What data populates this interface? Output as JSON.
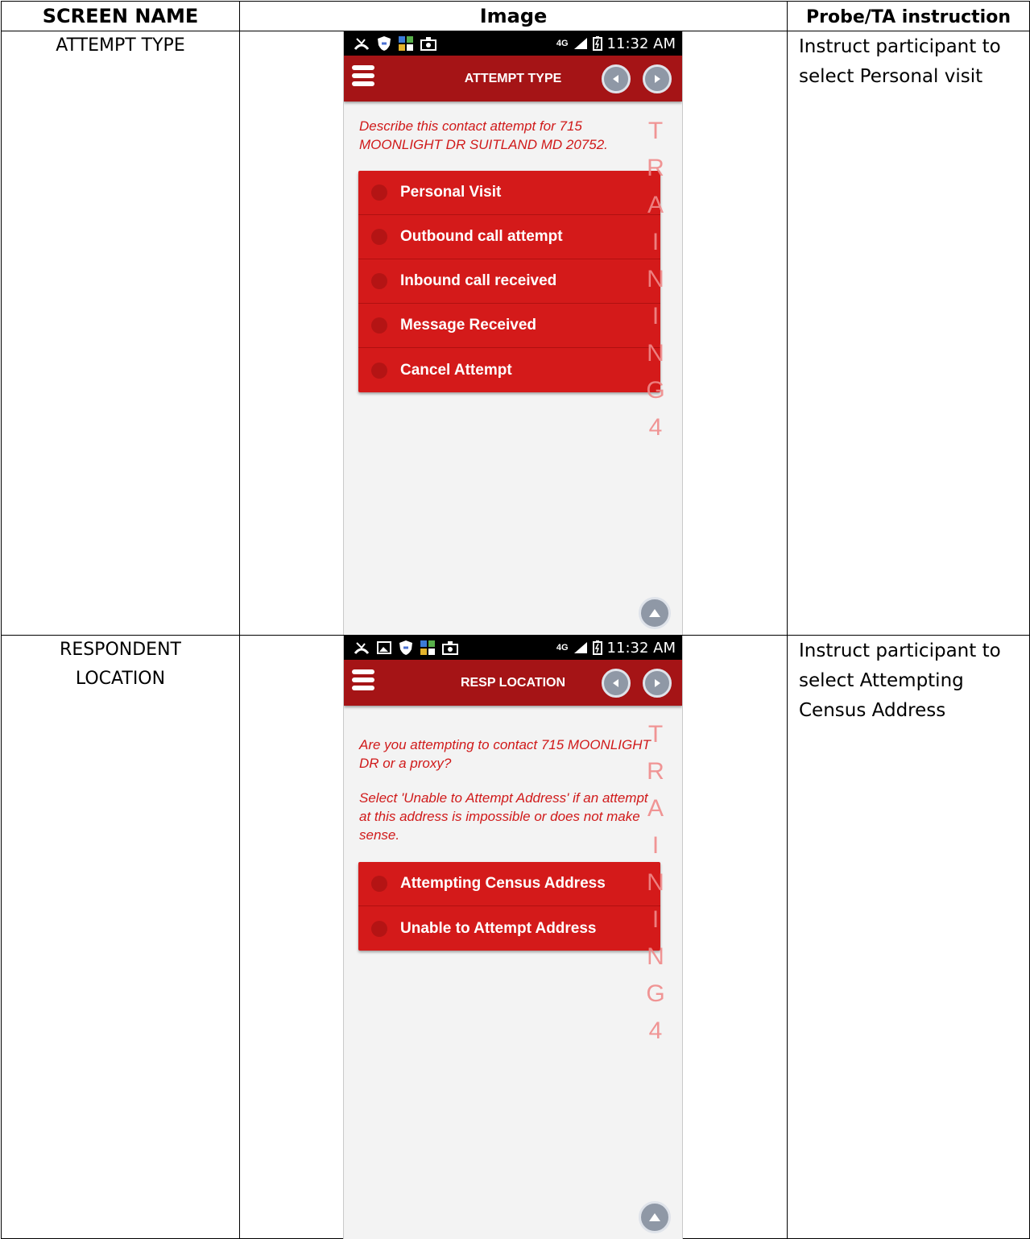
{
  "headers": {
    "screen_name": "SCREEN NAME",
    "image": "Image",
    "probe": "Probe/TA instruction"
  },
  "rows": [
    {
      "screen_name": "ATTEMPT TYPE",
      "probe": "Instruct participant to select Personal visit",
      "phone": {
        "time": "11:32 AM",
        "network": "4G",
        "title": "ATTEMPT TYPE",
        "prompt": "Describe this contact attempt for 715 MOONLIGHT DR SUITLAND MD 20752.",
        "prompt2": "",
        "options": [
          "Personal Visit",
          "Outbound call attempt",
          "Inbound call received",
          "Message Received",
          "Cancel Attempt"
        ],
        "watermark": [
          "T",
          "R",
          "A",
          "I",
          "N",
          "I",
          "N",
          "G",
          "4"
        ]
      }
    },
    {
      "screen_name": "RESPONDENT LOCATION",
      "probe": "Instruct participant to select Attempting Census Address",
      "phone": {
        "time": "11:32 AM",
        "network": "4G",
        "title": "RESP LOCATION",
        "prompt": "Are you attempting to contact 715 MOONLIGHT DR or a proxy?",
        "prompt2": "Select 'Unable to Attempt Address' if an attempt at this address is impossible or does not make sense.",
        "options": [
          "Attempting Census Address",
          "Unable to Attempt Address"
        ],
        "watermark": [
          "T",
          "R",
          "A",
          "I",
          "N",
          "I",
          "N",
          "G",
          "4"
        ]
      }
    }
  ],
  "colors": {
    "app_bar": "#a51416",
    "option_bg": "#d41a1a",
    "prompt_text": "#d01a1a",
    "watermark": "#f08a8a"
  },
  "icons": [
    "missed-call-icon",
    "gallery-icon",
    "shield-icon",
    "apps-icon",
    "camera-icon",
    "signal-icon",
    "battery-icon",
    "menu-icon",
    "back-arrow-icon",
    "forward-arrow-icon",
    "scroll-up-icon"
  ]
}
